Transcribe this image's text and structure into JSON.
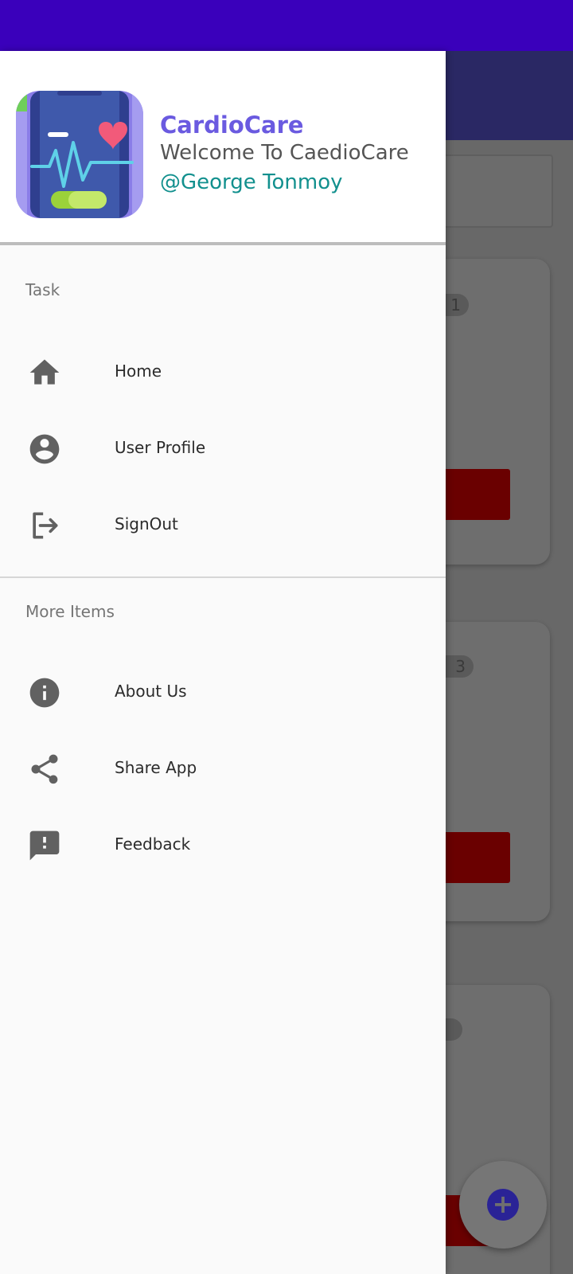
{
  "colors": {
    "status_bar": "#3a00bb",
    "app_name": "#6a5ae0",
    "username": "#12908e",
    "icon": "#616161"
  },
  "header": {
    "logo_icon": "heartbeat-phone-icon",
    "app_name": "CardioCare",
    "welcome": "Welcome To CaedioCare",
    "username": "@George Tonmoy"
  },
  "sections": [
    {
      "title": "Task",
      "items": [
        {
          "label": "Home",
          "icon": "home-icon"
        },
        {
          "label": "User Profile",
          "icon": "account-circle-icon"
        },
        {
          "label": "SignOut",
          "icon": "logout-icon"
        }
      ]
    },
    {
      "title": "More Items",
      "items": [
        {
          "label": "About Us",
          "icon": "info-icon"
        },
        {
          "label": "Share App",
          "icon": "share-icon"
        },
        {
          "label": "Feedback",
          "icon": "feedback-icon"
        }
      ]
    }
  ],
  "background": {
    "card_badges": [
      "1",
      "3",
      ""
    ],
    "fab_icon": "plus-icon"
  }
}
